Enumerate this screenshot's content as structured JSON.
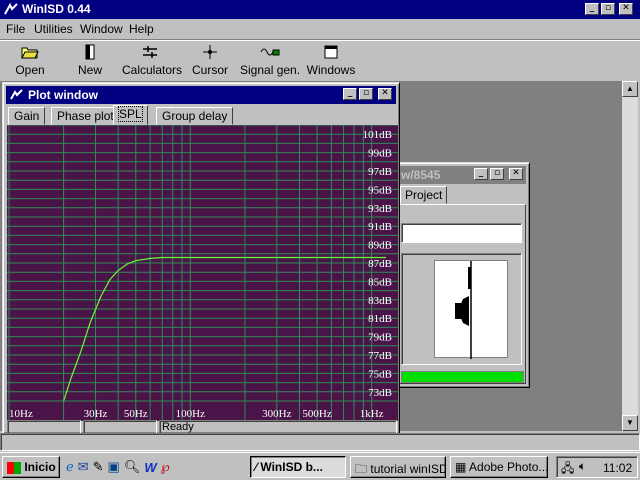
{
  "app": {
    "title": "WinISD 0.44"
  },
  "menu": [
    {
      "label": "File"
    },
    {
      "label": "Utilities"
    },
    {
      "label": "Window"
    },
    {
      "label": "Help"
    }
  ],
  "toolbar": [
    {
      "label": "Open",
      "icon": "folder-icon"
    },
    {
      "label": "New",
      "icon": "new-speaker-icon"
    },
    {
      "label": "Calculators",
      "icon": "calculator-icon"
    },
    {
      "label": "Cursor",
      "icon": "cursor-icon"
    },
    {
      "label": "Signal gen.",
      "icon": "signal-generator-icon"
    },
    {
      "label": "Windows",
      "icon": "windows-icon"
    }
  ],
  "plot_window": {
    "title": "Plot window",
    "tabs": [
      {
        "label": "Gain"
      },
      {
        "label": "Phase plot"
      },
      {
        "label": "SPL",
        "active": true
      },
      {
        "label": "Group delay"
      }
    ],
    "status": {
      "left": "",
      "middle": "",
      "right": "Ready"
    }
  },
  "driver_window": {
    "title": "w/8545",
    "tab": "Project",
    "name_value": "",
    "progress_color": "#00e000"
  },
  "colors": {
    "plot_bg": "#4a1449",
    "grid": "#2e8b57",
    "curve": "#66ff33",
    "title_active": "#000080"
  },
  "chart_data": {
    "type": "line",
    "title": "",
    "xlabel": "",
    "ylabel": "",
    "x_scale": "log",
    "xlim": [
      10,
      1200
    ],
    "ylim": [
      72,
      102
    ],
    "grid": true,
    "x_ticks": [
      {
        "value": 10,
        "label": "10Hz"
      },
      {
        "value": 30,
        "label": "30Hz"
      },
      {
        "value": 50,
        "label": "50Hz"
      },
      {
        "value": 100,
        "label": "100Hz"
      },
      {
        "value": 300,
        "label": "300Hz"
      },
      {
        "value": 500,
        "label": "500Hz"
      },
      {
        "value": 1000,
        "label": "1kHz"
      }
    ],
    "y_ticks": [
      {
        "value": 101,
        "label": "101dB"
      },
      {
        "value": 99,
        "label": "99dB"
      },
      {
        "value": 97,
        "label": "97dB"
      },
      {
        "value": 95,
        "label": "95dB"
      },
      {
        "value": 93,
        "label": "93dB"
      },
      {
        "value": 91,
        "label": "91dB"
      },
      {
        "value": 89,
        "label": "89dB"
      },
      {
        "value": 87,
        "label": "87dB"
      },
      {
        "value": 85,
        "label": "85dB"
      },
      {
        "value": 83,
        "label": "83dB"
      },
      {
        "value": 81,
        "label": "81dB"
      },
      {
        "value": 79,
        "label": "79dB"
      },
      {
        "value": 77,
        "label": "77dB"
      },
      {
        "value": 75,
        "label": "75dB"
      },
      {
        "value": 73,
        "label": "73dB"
      }
    ],
    "series": [
      {
        "x": [
          20,
          22,
          25,
          28,
          32,
          36,
          40,
          45,
          50,
          60,
          70,
          80,
          100,
          200,
          500,
          1200
        ],
        "y": [
          72,
          74.5,
          77.5,
          80.5,
          83.3,
          85.2,
          86.2,
          86.9,
          87.25,
          87.5,
          87.6,
          87.6,
          87.6,
          87.6,
          87.6,
          87.6
        ]
      }
    ]
  },
  "status_bar": {
    "text": ""
  },
  "taskbar": {
    "start": "Inicio",
    "tasks": [
      {
        "label": "WinISD b...",
        "active": true
      },
      {
        "label": "tutorial winISD",
        "active": false
      },
      {
        "label": "Adobe Photo...",
        "active": false
      }
    ],
    "clock": "11:02"
  }
}
